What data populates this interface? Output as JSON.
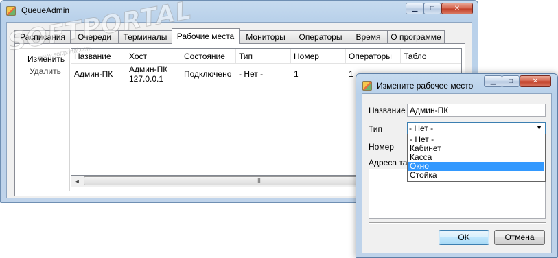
{
  "main_window": {
    "title": "QueueAdmin",
    "tabs": [
      {
        "label": "Расписания",
        "active": false
      },
      {
        "label": "Очереди",
        "active": false
      },
      {
        "label": "Терминалы",
        "active": false
      },
      {
        "label": "Рабочие места",
        "active": true
      },
      {
        "label": "Мониторы",
        "active": false
      },
      {
        "label": "Операторы",
        "active": false
      },
      {
        "label": "Время",
        "active": false
      },
      {
        "label": "О программе",
        "active": false
      }
    ],
    "side_buttons": {
      "edit": "Изменить",
      "delete": "Удалить"
    },
    "table": {
      "columns": [
        "Название",
        "Хост",
        "Состояние",
        "Тип",
        "Номер",
        "Операторы",
        "Табло"
      ],
      "rows": [
        {
          "name": "Админ-ПК",
          "host_line1": "Админ-ПК",
          "host_line2": "127.0.0.1",
          "state": "Подключено",
          "type": "- Нет -",
          "number": "1",
          "operators": "1",
          "board": ""
        }
      ]
    },
    "scrollbar": {
      "left_arrow": "◄",
      "right_arrow": "►",
      "grip": "III"
    }
  },
  "watermark": {
    "logo": "SOFTPORTAL",
    "sub": "www.softportal.com"
  },
  "dialog": {
    "title": "Измените рабочее место",
    "labels": {
      "name": "Название",
      "type": "Тип",
      "number": "Номер",
      "board_address": "Адреса таб"
    },
    "name_value": "Админ-ПК",
    "type_value": "- Нет -",
    "type_options": [
      "- Нет -",
      "Кабинет",
      "Касса",
      "Окно",
      "Стойка"
    ],
    "highlighted_option": "Окно",
    "ok_label": "OK",
    "cancel_label": "Отмена"
  },
  "colors": {
    "accent": "#3399ff",
    "title_bar": "#b9d1ea",
    "close_button": "#c13e26"
  }
}
